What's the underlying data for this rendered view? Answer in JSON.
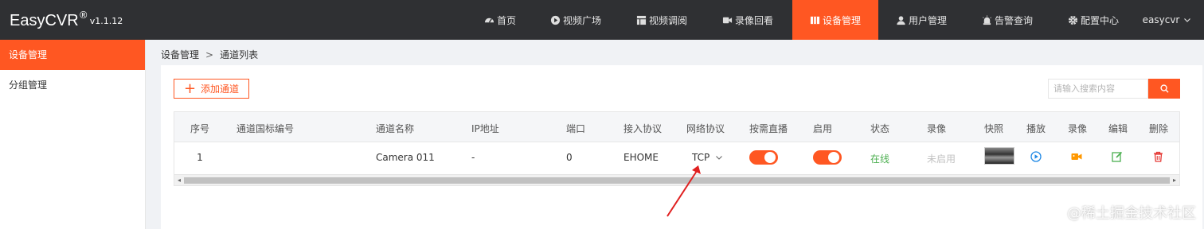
{
  "header": {
    "brand": "EasyCVR",
    "brand_reg": "®",
    "version": "v1.1.12",
    "nav": [
      {
        "label": "首页",
        "icon": "dashboard-icon"
      },
      {
        "label": "视频广场",
        "icon": "play-circle-icon"
      },
      {
        "label": "视频调阅",
        "icon": "grid-icon"
      },
      {
        "label": "录像回看",
        "icon": "video-camera-icon"
      },
      {
        "label": "设备管理",
        "icon": "device-icon",
        "active": true
      },
      {
        "label": "用户管理",
        "icon": "user-icon"
      },
      {
        "label": "告警查询",
        "icon": "alarm-icon"
      },
      {
        "label": "配置中心",
        "icon": "gear-icon"
      }
    ],
    "user": "easycvr",
    "accent_color": "#ff5722"
  },
  "sidebar": {
    "items": [
      {
        "label": "设备管理",
        "active": true
      },
      {
        "label": "分组管理",
        "active": false
      }
    ]
  },
  "breadcrumb": {
    "parent": "设备管理",
    "separator": ">",
    "current": "通道列表"
  },
  "toolbar": {
    "add_label": "添加通道",
    "search_placeholder": "请输入搜索内容"
  },
  "table": {
    "columns": [
      "序号",
      "通道国标编号",
      "通道名称",
      "IP地址",
      "端口",
      "接入协议",
      "网络协议",
      "按需直播",
      "启用",
      "状态",
      "录像",
      "快照",
      "播放",
      "录像",
      "编辑",
      "删除"
    ],
    "rows": [
      {
        "index": "1",
        "gb_id": "",
        "name": "Camera 011",
        "ip": "-",
        "port": "0",
        "access_protocol": "EHOME",
        "network_protocol": "TCP",
        "on_demand": true,
        "enabled": true,
        "status": "在线",
        "record": "未启用"
      }
    ]
  },
  "watermark": "@稀土掘金技术社区"
}
